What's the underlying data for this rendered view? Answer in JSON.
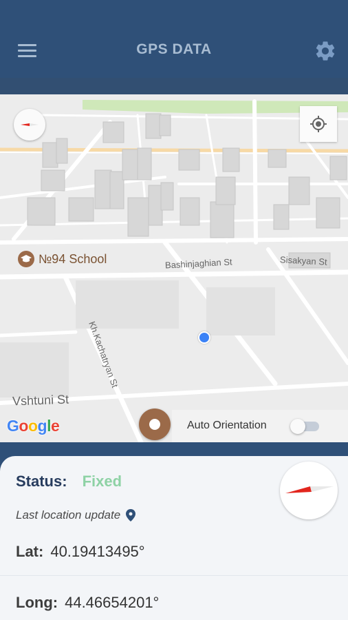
{
  "app": {
    "title": "GPS DATA",
    "menu_icon": "hamburger-menu-icon",
    "settings_icon": "gear-icon"
  },
  "map": {
    "poi": {
      "label": "№94 School",
      "icon": "school-icon"
    },
    "streets": {
      "bashinjaghian": "Bashinjaghian St",
      "sisakyan": "Sisakyan St",
      "khachatryan": "Kh.Kachatryan St",
      "vshtuni": "Vshtuni St"
    },
    "attribution": "Google",
    "auto_orientation_label": "Auto Orientation",
    "auto_orientation_on": false
  },
  "status": {
    "label": "Status:",
    "value": "Fixed",
    "value_color": "#8ed2a5"
  },
  "last_update": {
    "label": "Last location update",
    "icon": "location-pin-icon"
  },
  "coordinates": {
    "lat_label": "Lat:",
    "lat_value": "40.19413495°",
    "long_label": "Long:",
    "long_value": "44.46654201°"
  },
  "colors": {
    "primary": "#2f5078",
    "accent_brown": "#9b6a49",
    "user_dot": "#3b82f6"
  }
}
